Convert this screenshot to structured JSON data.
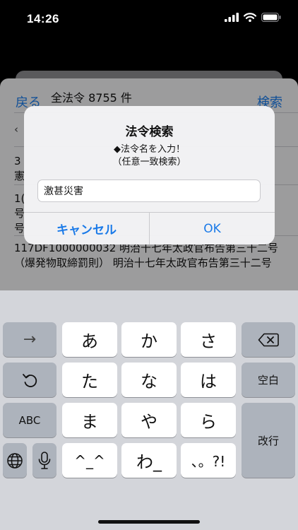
{
  "status_bar": {
    "time": "14:26"
  },
  "nav": {
    "back_label": "戻る",
    "title": "全法令 8755 件",
    "search_label": "検索"
  },
  "list": {
    "rows_partial": [
      "‹",
      "3",
      "憲",
      "1(",
      "号",
      "号"
    ],
    "law_entry": "117DF1000000032 明治十七年太政官布告第三十二号（爆発物取締罰則） 明治十七年太政官布告第三十二号"
  },
  "alert": {
    "title": "法令検索",
    "message_line1": "◆法令名を入力！",
    "message_line2": "（任意一致検索）",
    "input_value": "激甚災害",
    "cancel_label": "キャンセル",
    "ok_label": "OK"
  },
  "keyboard": {
    "keys": {
      "arrow": "→",
      "a": "あ",
      "ka": "か",
      "sa": "さ",
      "ta": "た",
      "na": "な",
      "ha": "は",
      "space": "空白",
      "abc": "ABC",
      "ma": "ま",
      "ya": "や",
      "ra": "ら",
      "return": "改行",
      "kaomoji": "^_^",
      "wa": "わ_",
      "punct": "、。?!"
    },
    "icons": [
      "delete-icon",
      "undo-icon",
      "globe-icon",
      "microphone-icon"
    ]
  },
  "colors": {
    "accent": "#1a7ae8",
    "keyboard_bg": "#d3d5da",
    "dark_key": "#adb3bc"
  }
}
